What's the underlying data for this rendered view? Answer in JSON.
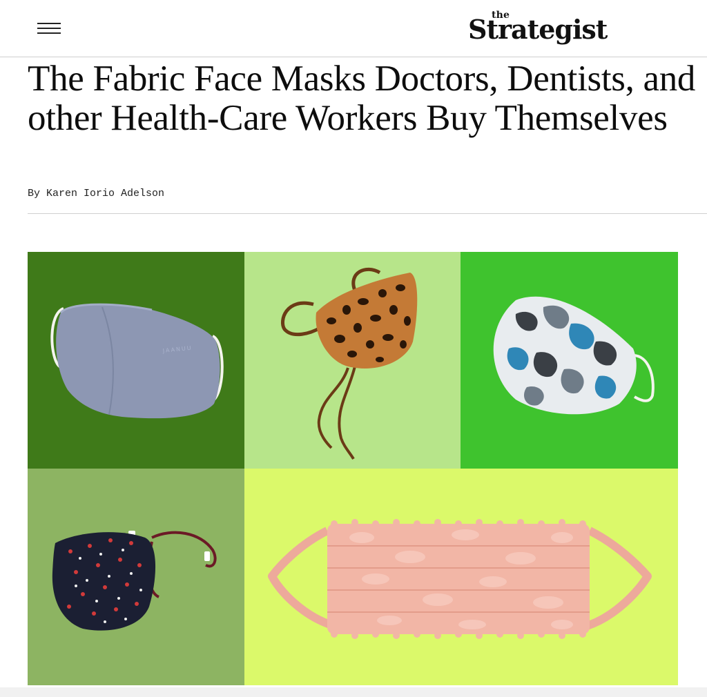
{
  "header": {
    "menu_icon": "hamburger-menu-icon",
    "logo_the": "the",
    "logo_main": "Strategist"
  },
  "article": {
    "headline": "The Fabric Face Masks Doctors, Dentists, and other Health-Care Workers Buy Themselves",
    "byline": "By Karen Iorio Adelson"
  },
  "hero_image": {
    "panels": [
      {
        "subject": "gray-fabric-mask",
        "bg": "#3f7a19",
        "brand_mark": "JAANUU"
      },
      {
        "subject": "leopard-print-tie-mask",
        "bg": "#b7e58a"
      },
      {
        "subject": "camo-print-mask",
        "bg": "#3fc32e"
      },
      {
        "subject": "floral-print-mask",
        "bg": "#8db462"
      },
      {
        "subject": "pink-lace-pleated-mask",
        "bg": "#dbf96a"
      }
    ]
  },
  "colors": {
    "text": "#111111",
    "rule": "#cfcfcf"
  }
}
